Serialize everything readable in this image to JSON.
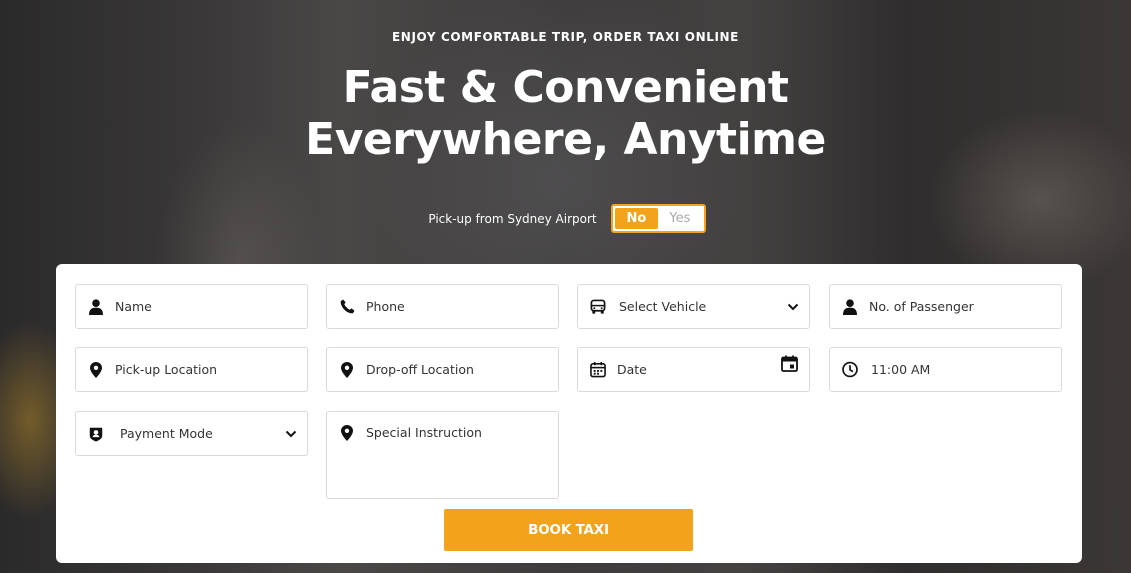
{
  "hero": {
    "kicker": "ENJOY COMFORTABLE TRIP, ORDER TAXI ONLINE",
    "headline_line1": "Fast & Convenient",
    "headline_line2": "Everywhere, Anytime"
  },
  "airport": {
    "label": "Pick-up from Sydney Airport",
    "no": "No",
    "yes": "Yes",
    "selected": "No"
  },
  "form": {
    "name": "Name",
    "phone": "Phone",
    "vehicle": "Select Vehicle",
    "passenger": "No. of Passenger",
    "pickup": "Pick-up Location",
    "dropoff": "Drop-off Location",
    "date": "Date",
    "time": "11:00 AM",
    "payment": "Payment Mode",
    "instruction": "Special Instruction",
    "submit": "BOOK TAXI"
  },
  "colors": {
    "accent": "#f2a21b"
  }
}
